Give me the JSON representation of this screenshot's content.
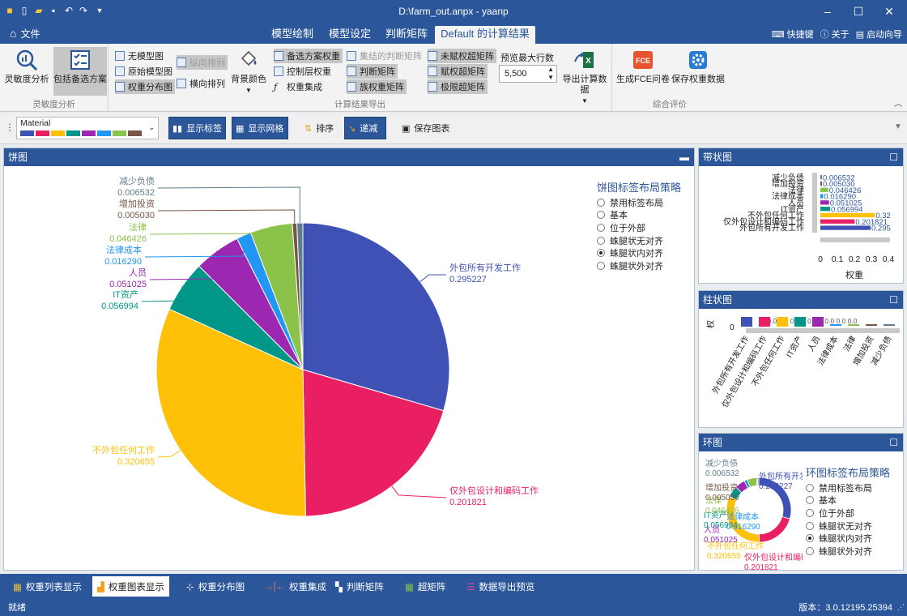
{
  "window": {
    "title": "D:\\farm_out.anpx - yaanp"
  },
  "menu": {
    "file": "文件",
    "tabs": [
      "模型绘制",
      "模型设定",
      "判断矩阵",
      "Default 的计算结果"
    ],
    "right": [
      "快捷键",
      "关于",
      "启动向导"
    ]
  },
  "ribbon": {
    "group1": {
      "label": "灵敏度分析",
      "btn1": "灵敏度分析",
      "btn2": "包括备选方案"
    },
    "group2": {
      "label": "计算结果导出",
      "c1": [
        "无模型图",
        "原始模型图",
        "权重分布图"
      ],
      "c2": [
        "纵向排列",
        "横向排列"
      ],
      "bg_color": "背景颜色",
      "c3": [
        "备选方案权重",
        "控制层权重",
        "权重集成"
      ],
      "c4": [
        "集结的判断矩阵",
        "判断矩阵",
        "族权重矩阵"
      ],
      "c5": [
        "未赋权超矩阵",
        "赋权超矩阵",
        "极限超矩阵"
      ],
      "preview_label": "预览最大行数",
      "preview_value": "5,500",
      "export": "导出计算数据"
    },
    "group3": {
      "label": "综合评价",
      "fce": "生成FCE问卷",
      "save": "保存权重数据",
      "fce_icon": "FCE"
    }
  },
  "toolbar": {
    "palette": "Material",
    "palette_colors": [
      "#3f51b5",
      "#e91e63",
      "#ffc107",
      "#009688",
      "#9c27b0",
      "#2196f3",
      "#8bc34a",
      "#795548"
    ],
    "show_labels": "显示标签",
    "show_grid": "显示网格",
    "sort": "排序",
    "decrease": "递减",
    "save_chart": "保存图表"
  },
  "pie_panel": {
    "title": "饼图",
    "strategy_title": "饼图标签布局策略",
    "options": [
      "禁用标签布局",
      "基本",
      "位于外部",
      "蛛腿状无对齐",
      "蛛腿状内对齐",
      "蛛腿状外对齐"
    ],
    "selected": 4
  },
  "strip_panel": {
    "title": "带状图",
    "axis_title": "权重",
    "ticks": [
      "0",
      "0.1",
      "0.2",
      "0.3",
      "0.4"
    ]
  },
  "bar_panel": {
    "title": "柱状图",
    "axis_title": "权",
    "zero": "0",
    "top_label": "0.0 0.0 0.0 0.0 0.0 0.0 0.0 0.0"
  },
  "ring_panel": {
    "title": "环图",
    "strategy_title": "环图标签布局策略",
    "options": [
      "禁用标签布局",
      "基本",
      "位于外部",
      "蛛腿状无对齐",
      "蛛腿状内对齐",
      "蛛腿状外对齐"
    ],
    "selected": 4
  },
  "bottom_tabs": [
    "权重列表显示",
    "权重图表显示",
    "权重分布图",
    "权重集成",
    "判断矩阵",
    "超矩阵",
    "数据导出预览"
  ],
  "status": {
    "left": "就绪",
    "version": "版本：3.0.12195.25394"
  },
  "chart_data": [
    {
      "type": "pie",
      "title": "",
      "categories": [
        "外包所有开发工作",
        "仅外包设计和编码工作",
        "不外包任何工作",
        "IT资产",
        "人员",
        "法律成本",
        "法律",
        "增加投资",
        "减少负债"
      ],
      "values": [
        0.295227,
        0.201821,
        0.320655,
        0.056994,
        0.051025,
        0.01629,
        0.046426,
        0.00503,
        0.006532
      ],
      "value_labels": [
        "0.295227",
        "0.201821",
        "0.320655",
        "0.056994",
        "0.051025",
        "0.016290",
        "0.046426",
        "0.005030",
        "0.006532"
      ],
      "colors": [
        "#3f51b5",
        "#e91e63",
        "#ffc107",
        "#009688",
        "#9c27b0",
        "#2196f3",
        "#8bc34a",
        "#795548",
        "#607d8b"
      ]
    },
    {
      "type": "bar",
      "orientation": "horizontal",
      "categories": [
        "减少负债",
        "增加投资",
        "法律",
        "法律成本",
        "人员",
        "IT资产",
        "不外包任何工作",
        "仅外包设计和编码工作",
        "外包所有开发工作"
      ],
      "values": [
        0.006532,
        0.00503,
        0.046426,
        0.01629,
        0.051025,
        0.056994,
        0.320655,
        0.201821,
        0.295227
      ],
      "value_labels": [
        "0.006532",
        "0.005030",
        "0.046426",
        "0.016290",
        "0.051025",
        "0.056994",
        "0.32",
        "0.201821",
        "0.295"
      ],
      "xlabel": "权重",
      "xlim": [
        0,
        0.4
      ]
    },
    {
      "type": "bar",
      "categories": [
        "外包所有开发工作",
        "仅外包设计和编码工作",
        "不外包任何工作",
        "IT资产",
        "人员",
        "法律成本",
        "法律",
        "增加投资",
        "减少负债"
      ],
      "ylabel": "权"
    },
    {
      "type": "pie",
      "variant": "doughnut",
      "categories": [
        "外包所有开发工作",
        "仅外包设计和编码工作",
        "不外包任何工作",
        "IT资产",
        "人员",
        "法律成本",
        "法律",
        "增加投资",
        "减少负债"
      ],
      "values": [
        0.295227,
        0.201821,
        0.320655,
        0.056994,
        0.051025,
        0.01629,
        0.046426,
        0.00503,
        0.006532
      ],
      "value_labels": [
        "0.295227",
        "0.201821",
        "0.320655",
        "0.056994",
        "0.051025",
        "0.016290",
        "0.046426",
        "0.005030",
        "0.006532"
      ]
    }
  ]
}
